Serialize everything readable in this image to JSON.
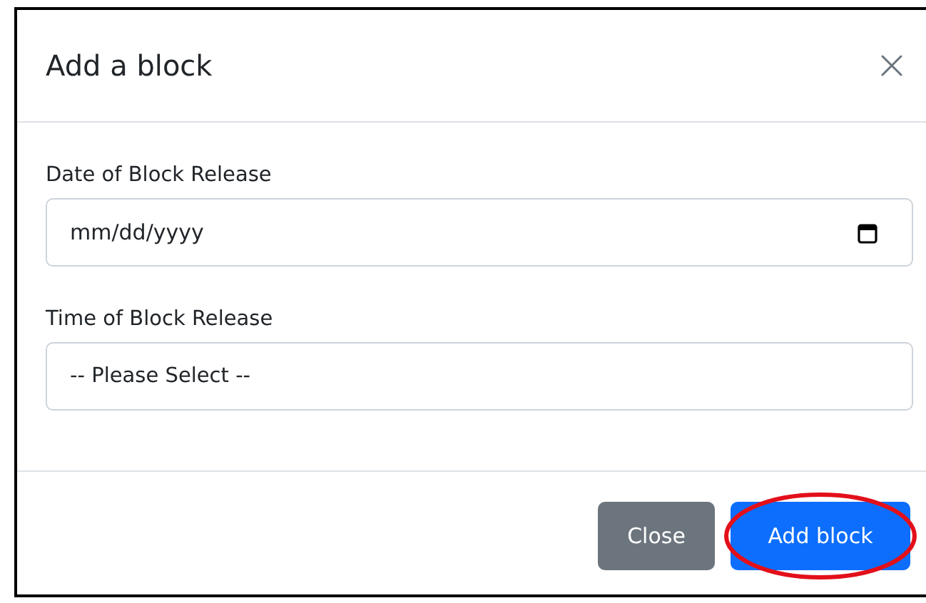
{
  "modal": {
    "title": "Add a block"
  },
  "fields": [
    {
      "kind": "date",
      "label": "Date of Block Release",
      "placeholder": "mm/dd/yyyy"
    },
    {
      "kind": "select",
      "label": "Time of Block Release",
      "value": "-- Please Select --"
    }
  ],
  "buttons": [
    {
      "kind": "secondary",
      "label": "Close",
      "highlighted": false
    },
    {
      "kind": "primary",
      "label": "Add block",
      "highlighted": true
    }
  ]
}
